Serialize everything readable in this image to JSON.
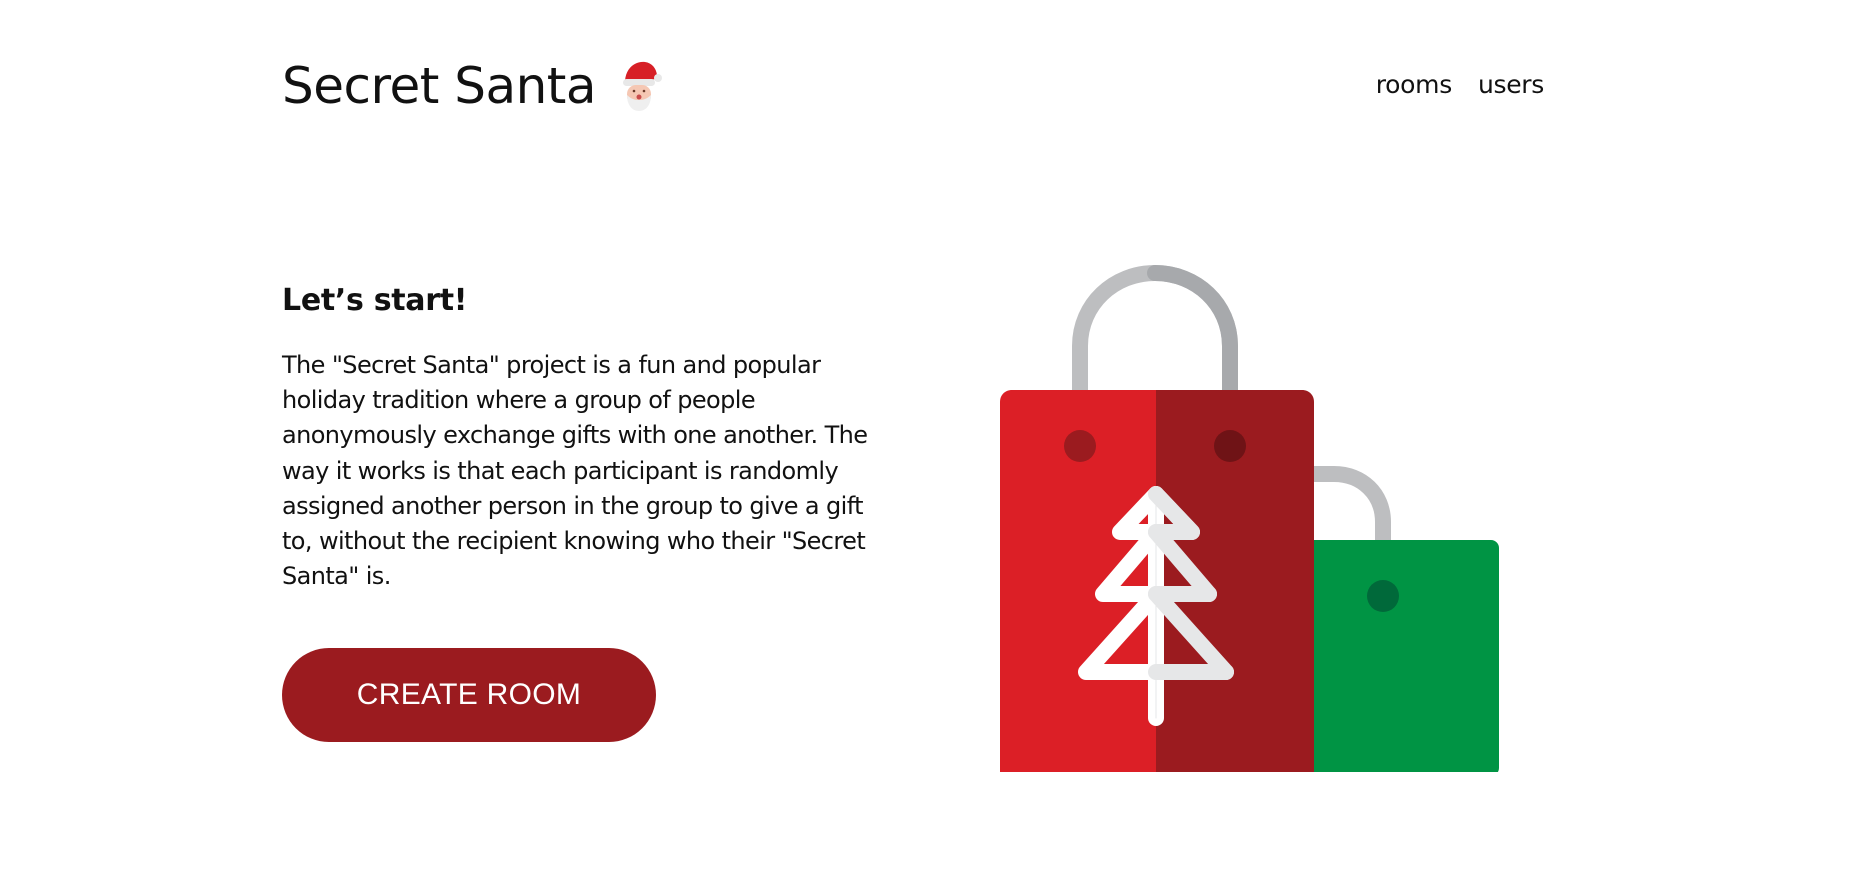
{
  "header": {
    "title": "Secret Santa",
    "logo_icon": "santa-face-icon"
  },
  "nav": {
    "rooms_label": "rooms",
    "users_label": "users"
  },
  "intro": {
    "heading": "Let’s start!",
    "description": "The \"Secret Santa\" project is a fun and popular holiday tradition where a group of people anonymously exchange gifts with one another. The way it works is that each participant is randomly assigned another person in the group to give a gift to, without the recipient knowing who their \"Secret Santa\" is.",
    "cta_label": "CREATE ROOM"
  },
  "illustration": {
    "icon": "shopping-bags-icon"
  },
  "colors": {
    "brand_red": "#9b1b1f",
    "bag_red": "#dc1f26",
    "bag_dark_red": "#9b1b1f",
    "bag_green": "#009444",
    "handle_gray": "#bdbec0"
  }
}
